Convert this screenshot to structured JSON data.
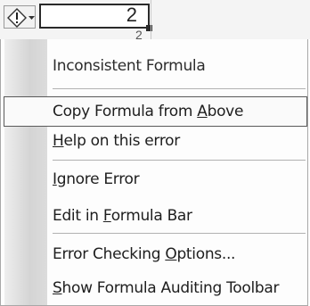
{
  "cell": {
    "value": "2",
    "next_value": "2"
  },
  "smart_tag": {
    "icon": "warning-icon",
    "arrow": "dropdown-arrow-icon"
  },
  "menu": {
    "header": "Inconsistent Formula",
    "items": [
      {
        "pre": "Copy Formula from ",
        "key": "A",
        "post": "bove",
        "highlighted": true
      },
      {
        "pre": "",
        "key": "H",
        "post": "elp on this error"
      },
      {
        "pre": "",
        "key": "I",
        "post": "gnore Error"
      },
      {
        "pre": "Edit in ",
        "key": "F",
        "post": "ormula Bar"
      },
      {
        "pre": "Error Checking ",
        "key": "O",
        "post": "ptions..."
      },
      {
        "pre": "",
        "key": "S",
        "post": "how Formula Auditing Toolbar"
      }
    ]
  }
}
